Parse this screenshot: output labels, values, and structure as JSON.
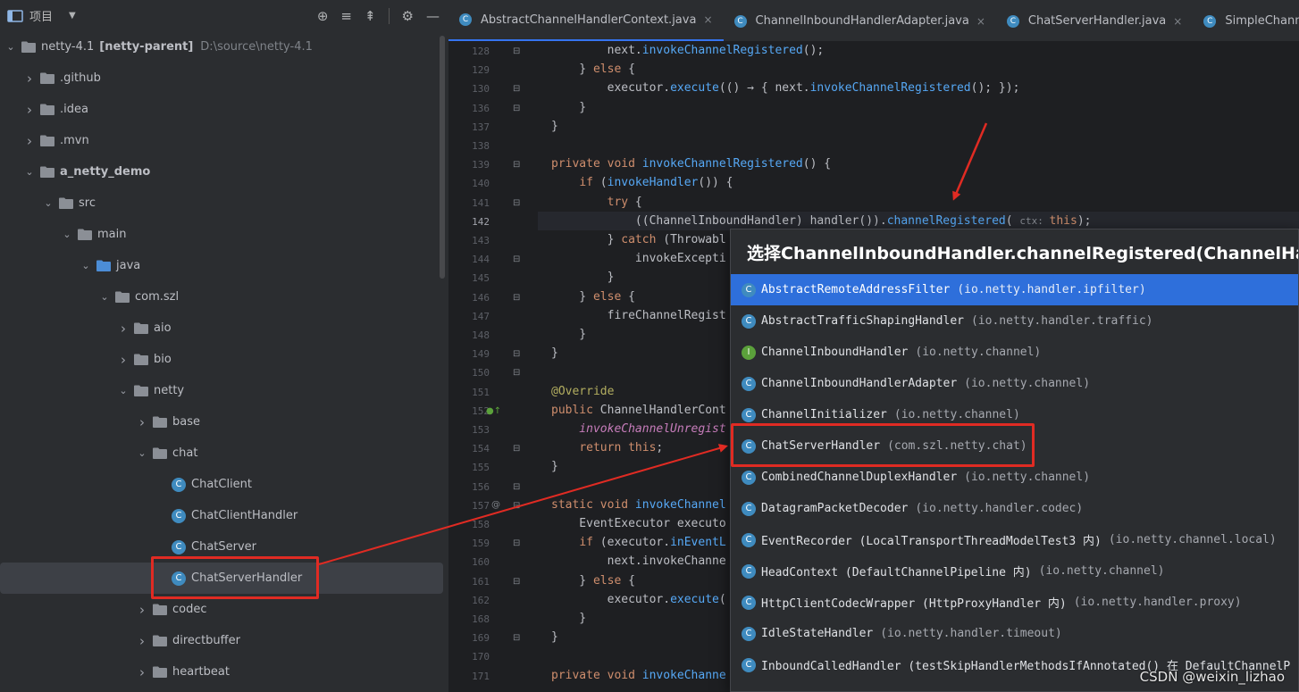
{
  "project_panel": {
    "title": "项目",
    "toolbar_icons": [
      "crosshair-icon",
      "expand-all-icon",
      "collapse-all-icon",
      "gear-icon",
      "minimize-icon"
    ],
    "tree": [
      {
        "label": "netty-4.1",
        "extra": "[netty-parent]",
        "path": "D:\\source\\netty-4.1",
        "depth": 0,
        "type": "module",
        "expanded": true
      },
      {
        "label": ".github",
        "depth": 1,
        "type": "folder",
        "expanded": false
      },
      {
        "label": ".idea",
        "depth": 1,
        "type": "folder",
        "expanded": false
      },
      {
        "label": ".mvn",
        "depth": 1,
        "type": "folder",
        "expanded": false
      },
      {
        "label": "a_netty_demo",
        "depth": 1,
        "type": "module",
        "expanded": true,
        "bold": true
      },
      {
        "label": "src",
        "depth": 2,
        "type": "folder",
        "expanded": true
      },
      {
        "label": "main",
        "depth": 3,
        "type": "folder",
        "expanded": true
      },
      {
        "label": "java",
        "depth": 4,
        "type": "source",
        "expanded": true
      },
      {
        "label": "com.szl",
        "depth": 5,
        "type": "package",
        "expanded": true
      },
      {
        "label": "aio",
        "depth": 6,
        "type": "package",
        "expanded": false
      },
      {
        "label": "bio",
        "depth": 6,
        "type": "package",
        "expanded": false
      },
      {
        "label": "netty",
        "depth": 6,
        "type": "package",
        "expanded": true
      },
      {
        "label": "base",
        "depth": 7,
        "type": "package",
        "expanded": false
      },
      {
        "label": "chat",
        "depth": 7,
        "type": "package",
        "expanded": true
      },
      {
        "label": "ChatClient",
        "depth": 8,
        "type": "class"
      },
      {
        "label": "ChatClientHandler",
        "depth": 8,
        "type": "class"
      },
      {
        "label": "ChatServer",
        "depth": 8,
        "type": "class"
      },
      {
        "label": "ChatServerHandler",
        "depth": 8,
        "type": "class",
        "selected": true
      },
      {
        "label": "codec",
        "depth": 7,
        "type": "package",
        "expanded": false
      },
      {
        "label": "directbuffer",
        "depth": 7,
        "type": "package",
        "expanded": false
      },
      {
        "label": "heartbeat",
        "depth": 7,
        "type": "package",
        "expanded": false
      }
    ]
  },
  "tabs": [
    {
      "label": "AbstractChannelHandlerContext.java",
      "active": true
    },
    {
      "label": "ChannelInboundHandlerAdapter.java",
      "active": false
    },
    {
      "label": "ChatServerHandler.java",
      "active": false
    },
    {
      "label": "SimpleChannelInbour",
      "active": false
    }
  ],
  "editor": {
    "current_line": "142",
    "lines": [
      {
        "n": "128",
        "code": [
          [
            "",
            "        next."
          ],
          [
            "fn",
            "invokeChannelRegistered"
          ],
          [
            "",
            "();"
          ]
        ]
      },
      {
        "n": "129",
        "code": [
          [
            "",
            "    } "
          ],
          [
            "kw",
            "else"
          ],
          [
            "",
            " {"
          ]
        ]
      },
      {
        "n": "130",
        "code": [
          [
            "",
            "        executor."
          ],
          [
            "fn",
            "execute"
          ],
          [
            "",
            "(() → { next."
          ],
          [
            "fn",
            "invokeChannelRegistered"
          ],
          [
            "",
            "(); });"
          ]
        ]
      },
      {
        "n": "136",
        "code": [
          [
            "",
            "    }"
          ]
        ]
      },
      {
        "n": "137",
        "code": [
          [
            "",
            "}"
          ]
        ]
      },
      {
        "n": "138",
        "code": []
      },
      {
        "n": "139",
        "code": [
          [
            "kw",
            "private void "
          ],
          [
            "fn",
            "invokeChannelRegistered"
          ],
          [
            "",
            "() {"
          ]
        ]
      },
      {
        "n": "140",
        "code": [
          [
            "",
            "    "
          ],
          [
            "kw",
            "if"
          ],
          [
            "",
            " ("
          ],
          [
            "fn",
            "invokeHandler"
          ],
          [
            "",
            "()) {"
          ]
        ]
      },
      {
        "n": "141",
        "code": [
          [
            "",
            "        "
          ],
          [
            "kw",
            "try"
          ],
          [
            "",
            " {"
          ]
        ]
      },
      {
        "n": "142",
        "code": [
          [
            "",
            "            ((ChannelInboundHandler) handler())."
          ],
          [
            "fn",
            "channelRegistered"
          ],
          [
            "",
            "( "
          ],
          [
            "hint",
            "ctx: "
          ],
          [
            "kw",
            "this"
          ],
          [
            "",
            ");"
          ]
        ]
      },
      {
        "n": "143",
        "code": [
          [
            "",
            "        } "
          ],
          [
            "kw",
            "catch"
          ],
          [
            "",
            " (Throwabl"
          ]
        ]
      },
      {
        "n": "144",
        "code": [
          [
            "",
            "            invokeExcepti"
          ]
        ]
      },
      {
        "n": "145",
        "code": [
          [
            "",
            "        }"
          ]
        ]
      },
      {
        "n": "146",
        "code": [
          [
            "",
            "    } "
          ],
          [
            "kw",
            "else"
          ],
          [
            "",
            " {"
          ]
        ]
      },
      {
        "n": "147",
        "code": [
          [
            "",
            "        fireChannelRegist"
          ]
        ]
      },
      {
        "n": "148",
        "code": [
          [
            "",
            "    }"
          ]
        ]
      },
      {
        "n": "149",
        "code": [
          [
            "",
            "}"
          ]
        ]
      },
      {
        "n": "150",
        "code": []
      },
      {
        "n": "151",
        "code": [
          [
            "ann",
            "@Override"
          ]
        ]
      },
      {
        "n": "152",
        "code": [
          [
            "kw",
            "public "
          ],
          [
            "",
            "ChannelHandlerCont"
          ]
        ]
      },
      {
        "n": "153",
        "code": [
          [
            "it",
            "    invokeChannelUnregist"
          ]
        ]
      },
      {
        "n": "154",
        "code": [
          [
            "",
            "    "
          ],
          [
            "kw",
            "return this"
          ],
          [
            "",
            ";"
          ]
        ]
      },
      {
        "n": "155",
        "code": [
          [
            "",
            "}"
          ]
        ]
      },
      {
        "n": "156",
        "code": []
      },
      {
        "n": "157",
        "code": [
          [
            "kw",
            "static void "
          ],
          [
            "fn",
            "invokeChannel"
          ]
        ]
      },
      {
        "n": "158",
        "code": [
          [
            "",
            "    EventExecutor executo"
          ]
        ]
      },
      {
        "n": "159",
        "code": [
          [
            "",
            "    "
          ],
          [
            "kw",
            "if"
          ],
          [
            "",
            " (executor."
          ],
          [
            "fn",
            "inEventL"
          ]
        ]
      },
      {
        "n": "160",
        "code": [
          [
            "",
            "        next.invokeChanne"
          ]
        ]
      },
      {
        "n": "161",
        "code": [
          [
            "",
            "    } "
          ],
          [
            "kw",
            "else"
          ],
          [
            "",
            " {"
          ]
        ]
      },
      {
        "n": "162",
        "code": [
          [
            "",
            "        executor."
          ],
          [
            "fn",
            "execute"
          ],
          [
            "",
            "("
          ]
        ]
      },
      {
        "n": "168",
        "code": [
          [
            "",
            "    }"
          ]
        ]
      },
      {
        "n": "169",
        "code": [
          [
            "",
            "}"
          ]
        ]
      },
      {
        "n": "170",
        "code": []
      },
      {
        "n": "171",
        "code": [
          [
            "kw",
            "private void "
          ],
          [
            "fn",
            "invokeChanne"
          ]
        ]
      }
    ]
  },
  "popup": {
    "title": "选择ChannelInboundHandler.channelRegistered(ChannelHand",
    "items": [
      {
        "name": "AbstractRemoteAddressFilter",
        "pkg": "(io.netty.handler.ipfilter)",
        "icon": "class",
        "selected": true
      },
      {
        "name": "AbstractTrafficShapingHandler",
        "pkg": "(io.netty.handler.traffic)",
        "icon": "class"
      },
      {
        "name": "ChannelInboundHandler",
        "pkg": "(io.netty.channel)",
        "icon": "interface"
      },
      {
        "name": "ChannelInboundHandlerAdapter",
        "pkg": "(io.netty.channel)",
        "icon": "class"
      },
      {
        "name": "ChannelInitializer",
        "pkg": "(io.netty.channel)",
        "icon": "class"
      },
      {
        "name": "ChatServerHandler",
        "pkg": "(com.szl.netty.chat)",
        "icon": "class",
        "highlighted": true
      },
      {
        "name": "CombinedChannelDuplexHandler",
        "pkg": "(io.netty.channel)",
        "icon": "class"
      },
      {
        "name": "DatagramPacketDecoder",
        "pkg": "(io.netty.handler.codec)",
        "icon": "class"
      },
      {
        "name": "EventRecorder (LocalTransportThreadModelTest3 内)",
        "pkg": "(io.netty.channel.local)",
        "icon": "class"
      },
      {
        "name": "HeadContext (DefaultChannelPipeline 内)",
        "pkg": "(io.netty.channel)",
        "icon": "class"
      },
      {
        "name": "HttpClientCodecWrapper (HttpProxyHandler 内)",
        "pkg": "(io.netty.handler.proxy)",
        "icon": "class"
      },
      {
        "name": "IdleStateHandler",
        "pkg": "(io.netty.handler.timeout)",
        "icon": "class"
      },
      {
        "name": "InboundCalledHandler (testSkipHandlerMethodsIfAnnotated() 在 DefaultChannelP",
        "pkg": "",
        "icon": "class"
      }
    ]
  },
  "watermark": "CSDN @weixin_lizhao",
  "colors": {
    "annotation_red": "#e02b23",
    "selection_blue": "#2e6fdb",
    "accent": "#3574f0"
  }
}
